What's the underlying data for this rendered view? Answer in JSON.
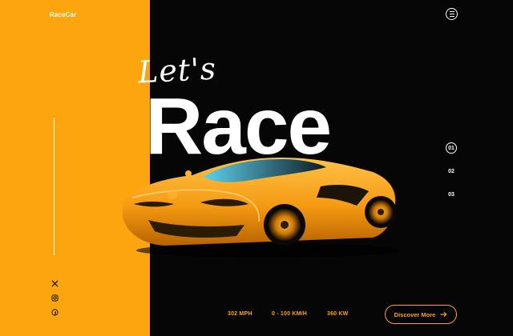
{
  "brand": {
    "name": "RaceCar"
  },
  "hero": {
    "lets": "Let's",
    "title": "Race"
  },
  "slides": [
    {
      "label": "01",
      "active": true
    },
    {
      "label": "02",
      "active": false
    },
    {
      "label": "03",
      "active": false
    }
  ],
  "stats": [
    {
      "label": "302 MPH"
    },
    {
      "label": "0 - 100 KM/H"
    },
    {
      "label": "360 KW"
    }
  ],
  "cta": {
    "label": "Discover More"
  },
  "icons": {
    "menu": "menu-icon",
    "social": [
      "x-icon",
      "instagram-icon",
      "facebook-icon"
    ],
    "arrow": "arrow-right-icon"
  },
  "colors": {
    "accent": "#fda50f",
    "background": "#060607",
    "text": "#ffffff"
  }
}
